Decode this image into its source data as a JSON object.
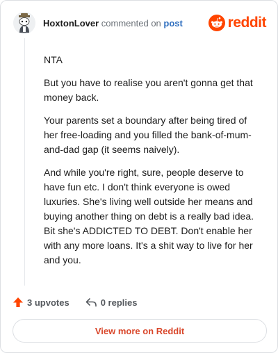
{
  "header": {
    "username": "HoxtonLover",
    "commented_text": "commented on",
    "post_link": "post",
    "avatar_icon": "snoo-avatar-icon",
    "logo_icon": "reddit-snoo-icon",
    "logo_text": "reddit"
  },
  "comment": {
    "paragraphs": [
      "NTA",
      "But you have to realise you aren't gonna get that money back.",
      "Your parents set a boundary after being tired of her free-loading and you filled the bank-of-mum-and-dad gap (it seems naively).",
      "And while you're right, sure, people deserve to have fun etc. I don't think everyone is owed luxuries. She's living well outside her means and buying another thing on debt is a really bad idea. Bit she's ADDICTED TO DEBT. Don't enable her with any more loans. It's a shit way to live for her and you."
    ]
  },
  "actions": {
    "upvotes": "3 upvotes",
    "upvote_icon": "upvote-arrow-icon",
    "replies": "0 replies",
    "reply_icon": "reply-arrow-icon"
  },
  "footer": {
    "view_more": "View more on Reddit"
  },
  "colors": {
    "accent": "#ff4500",
    "link": "#2f6fbf",
    "view_more_text": "#d9472b"
  }
}
